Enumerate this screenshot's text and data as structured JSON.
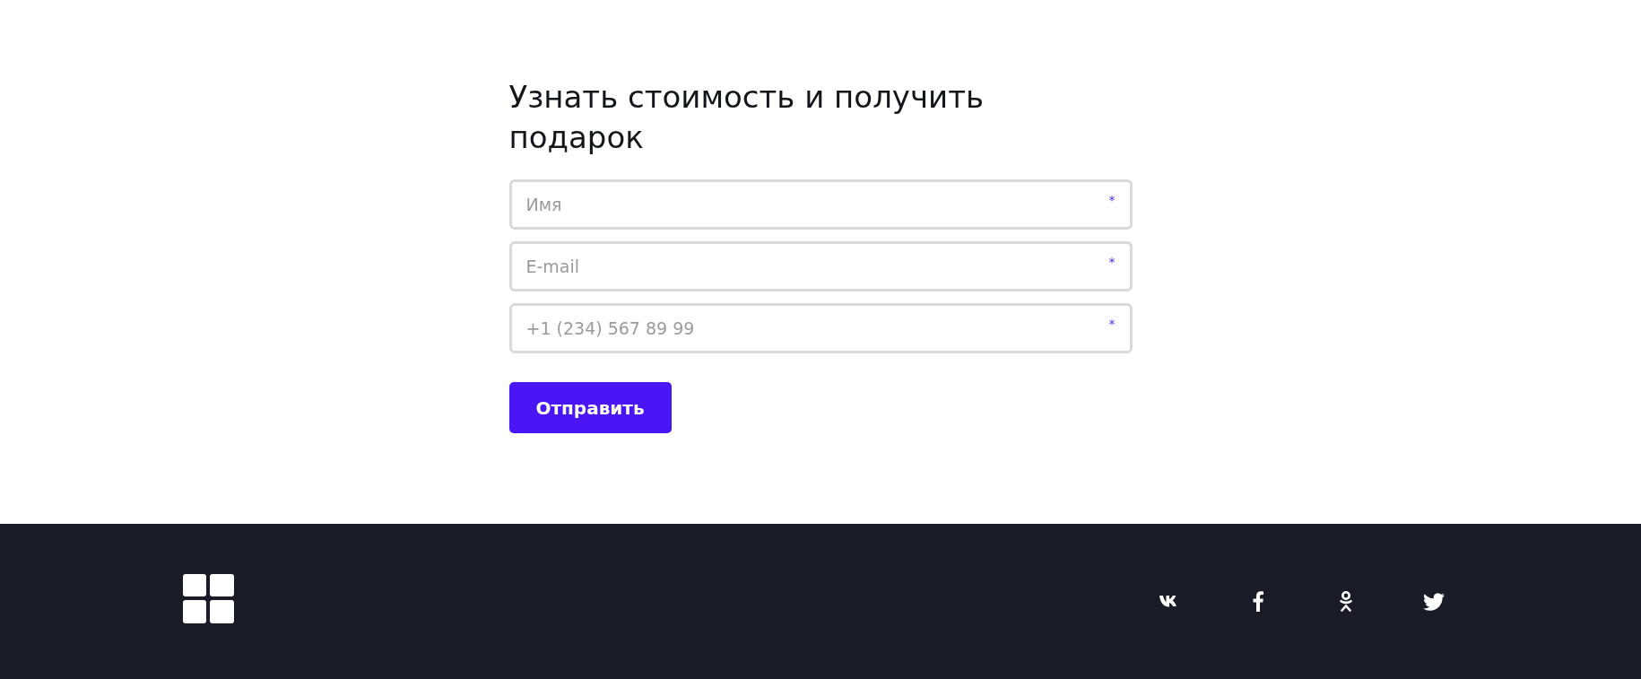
{
  "form": {
    "title": "Узнать стоимость и получить подарок",
    "fields": [
      {
        "placeholder": "Имя",
        "required_mark": "*"
      },
      {
        "placeholder": "E-mail",
        "required_mark": "*"
      },
      {
        "placeholder": "+1 (234) 567 89 99",
        "required_mark": "*"
      }
    ],
    "submit_button": "Отправить"
  }
}
